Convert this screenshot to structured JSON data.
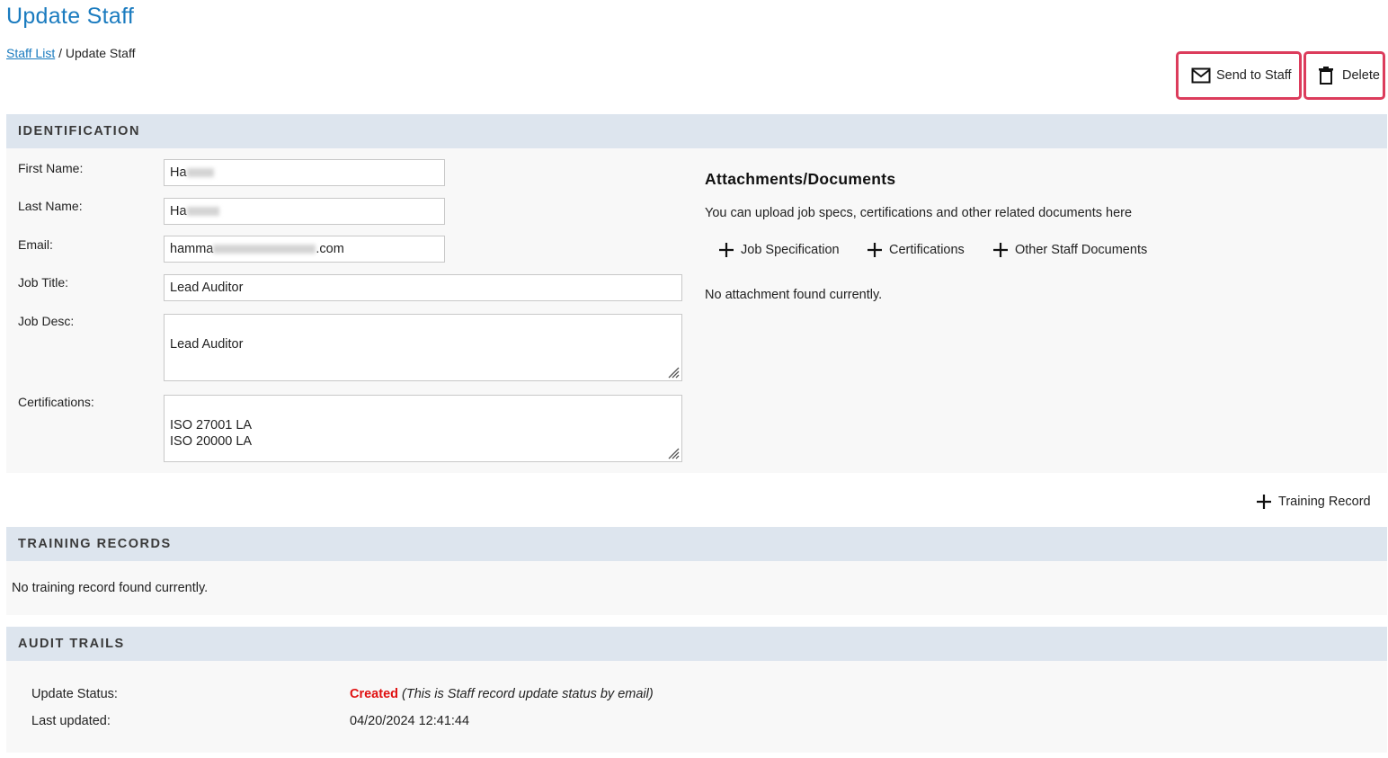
{
  "page": {
    "title": "Update Staff",
    "breadcrumb_link": "Staff List",
    "breadcrumb_sep": " / ",
    "breadcrumb_current": "Update Staff"
  },
  "actions": {
    "send_label": "Send to Staff",
    "delete_label": "Delete",
    "highlight_color": "#dc3c5c"
  },
  "identification": {
    "heading": "IDENTIFICATION",
    "first_name_label": "First Name:",
    "first_name_value": "Ha",
    "last_name_label": "Last Name:",
    "last_name_value": "Ha",
    "email_label": "Email:",
    "email_value_start": "hamma",
    "email_value_end": ".com",
    "job_title_label": "Job Title:",
    "job_title_value": "Lead Auditor",
    "job_desc_label": "Job Desc:",
    "job_desc_value": "Lead Auditor",
    "certifications_label": "Certifications:",
    "certifications_value": "ISO 27001 LA\nISO 20000 LA"
  },
  "attachments": {
    "heading": "Attachments/Documents",
    "description": "You can upload job specs, certifications and other related documents here",
    "add_job_spec": "Job Specification",
    "add_certifications": "Certifications",
    "add_other": "Other Staff Documents",
    "empty_text": "No attachment found currently."
  },
  "training": {
    "add_label": "Training Record",
    "heading": "TRAINING RECORDS",
    "empty_text": "No training record found currently."
  },
  "audit": {
    "heading": "AUDIT TRAILS",
    "status_label": "Update Status:",
    "status_value": "Created",
    "status_note": "(This is Staff record update status by email)",
    "status_color": "#e01010",
    "updated_label": "Last updated:",
    "updated_value": "04/20/2024 12:41:44"
  },
  "colors": {
    "link": "#1a7bbf",
    "section_header": "#dde5ee"
  }
}
